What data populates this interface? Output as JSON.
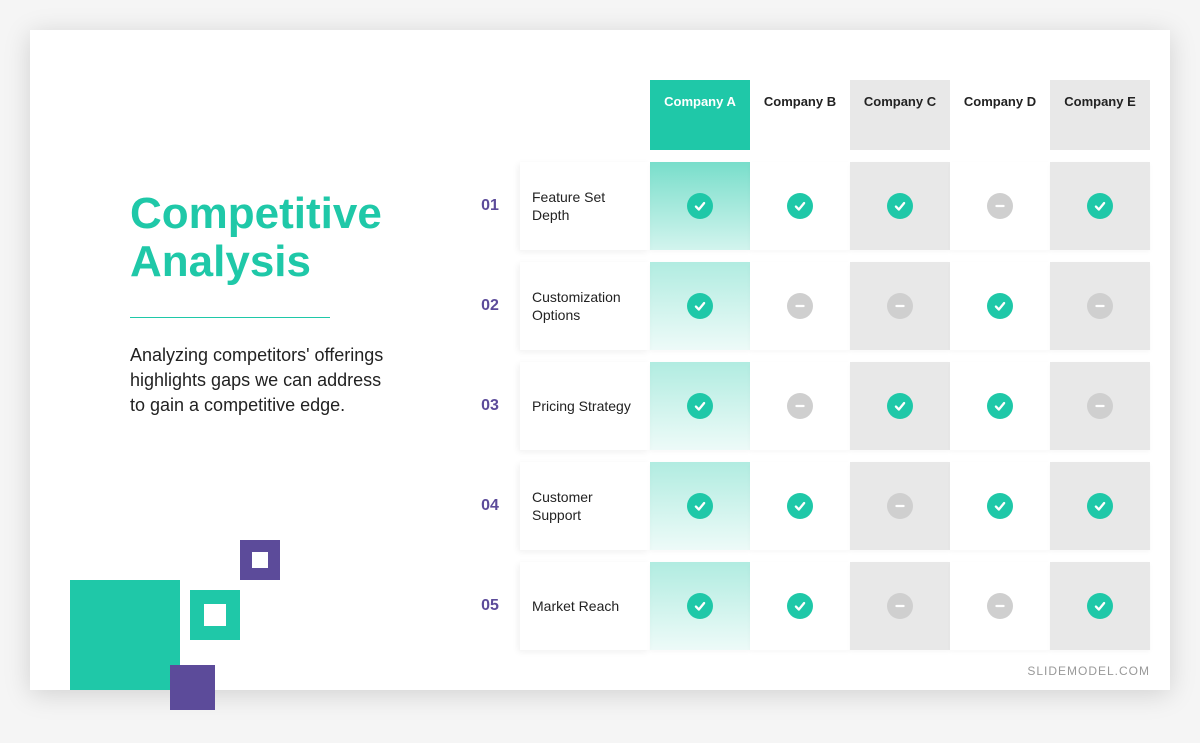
{
  "title": "Competitive Analysis",
  "description": "Analyzing competitors' offerings highlights gaps we can address to gain a competitive edge.",
  "watermark": "SLIDEMODEL.COM",
  "companies": [
    "Company A",
    "Company B",
    "Company C",
    "Company D",
    "Company E"
  ],
  "feature_rows": [
    {
      "num": "01",
      "label": "Feature Set Depth"
    },
    {
      "num": "02",
      "label": "Customization Options"
    },
    {
      "num": "03",
      "label": "Pricing Strategy"
    },
    {
      "num": "04",
      "label": "Customer Support"
    },
    {
      "num": "05",
      "label": "Market Reach"
    }
  ],
  "chart_data": {
    "type": "table",
    "title": "Competitive Analysis",
    "columns": [
      "Company A",
      "Company B",
      "Company C",
      "Company D",
      "Company E"
    ],
    "rows": [
      "Feature Set Depth",
      "Customization Options",
      "Pricing Strategy",
      "Customer Support",
      "Market Reach"
    ],
    "values": [
      [
        true,
        true,
        true,
        false,
        true
      ],
      [
        true,
        false,
        false,
        true,
        false
      ],
      [
        true,
        false,
        true,
        true,
        false
      ],
      [
        true,
        true,
        false,
        true,
        true
      ],
      [
        true,
        true,
        false,
        false,
        true
      ]
    ],
    "highlight_column": 0
  }
}
